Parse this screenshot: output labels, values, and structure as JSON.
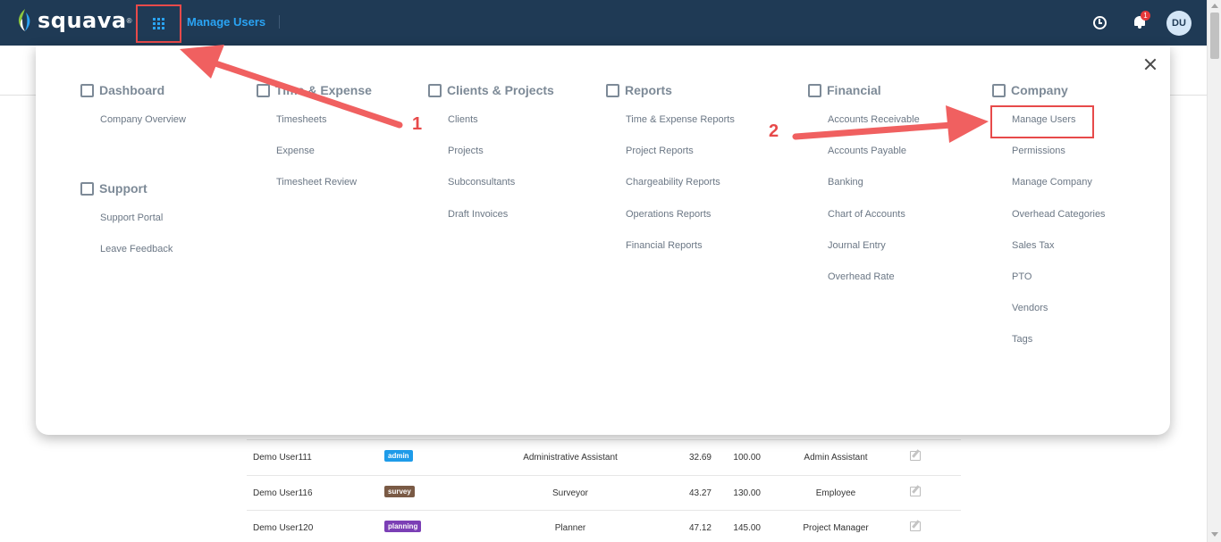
{
  "topbar": {
    "brand": "squava",
    "brand_mark": "®",
    "current_page": "Manage Users",
    "notification_count": "1",
    "avatar_initials": "DU",
    "colors": {
      "background": "#1f3a55",
      "accent": "#2aa4f4",
      "highlight": "#e74a4a"
    }
  },
  "menu": {
    "columns": [
      {
        "heading": "Dashboard",
        "icon": "dashboard-icon",
        "items": [
          "Company Overview"
        ]
      },
      {
        "heading": "Support",
        "icon": "question-icon",
        "items": [
          "Support Portal",
          "Leave Feedback"
        ]
      },
      {
        "heading": "Time & Expense",
        "icon": "calendar-icon",
        "items": [
          "Timesheets",
          "Expense",
          "Timesheet Review"
        ]
      },
      {
        "heading": "Clients & Projects",
        "icon": "briefcase-icon",
        "items": [
          "Clients",
          "Projects",
          "Subconsultants",
          "Draft Invoices"
        ]
      },
      {
        "heading": "Reports",
        "icon": "document-icon",
        "items": [
          "Time & Expense Reports",
          "Project Reports",
          "Chargeability Reports",
          "Operations Reports",
          "Financial Reports"
        ]
      },
      {
        "heading": "Financial",
        "icon": "calculator-icon",
        "items": [
          "Accounts Receivable",
          "Accounts Payable",
          "Banking",
          "Chart of Accounts",
          "Journal Entry",
          "Overhead Rate"
        ]
      },
      {
        "heading": "Company",
        "icon": "building-icon",
        "items": [
          "Manage Users",
          "Permissions",
          "Manage Company",
          "Overhead Categories",
          "Sales Tax",
          "PTO",
          "Vendors",
          "Tags"
        ]
      }
    ]
  },
  "annotations": {
    "step1": "1",
    "step2": "2"
  },
  "users_table": {
    "rows": [
      {
        "name": "Demo User111",
        "tag": "admin",
        "tag_color": "#1e9be9",
        "title": "Administrative Assistant",
        "rate1": "32.69",
        "rate2": "100.00",
        "role": "Admin Assistant"
      },
      {
        "name": "Demo User116",
        "tag": "survey",
        "tag_color": "#7a5a45",
        "title": "Surveyor",
        "rate1": "43.27",
        "rate2": "130.00",
        "role": "Employee"
      },
      {
        "name": "Demo User120",
        "tag": "planning",
        "tag_color": "#7b3fb5",
        "title": "Planner",
        "rate1": "47.12",
        "rate2": "145.00",
        "role": "Project Manager"
      }
    ]
  }
}
